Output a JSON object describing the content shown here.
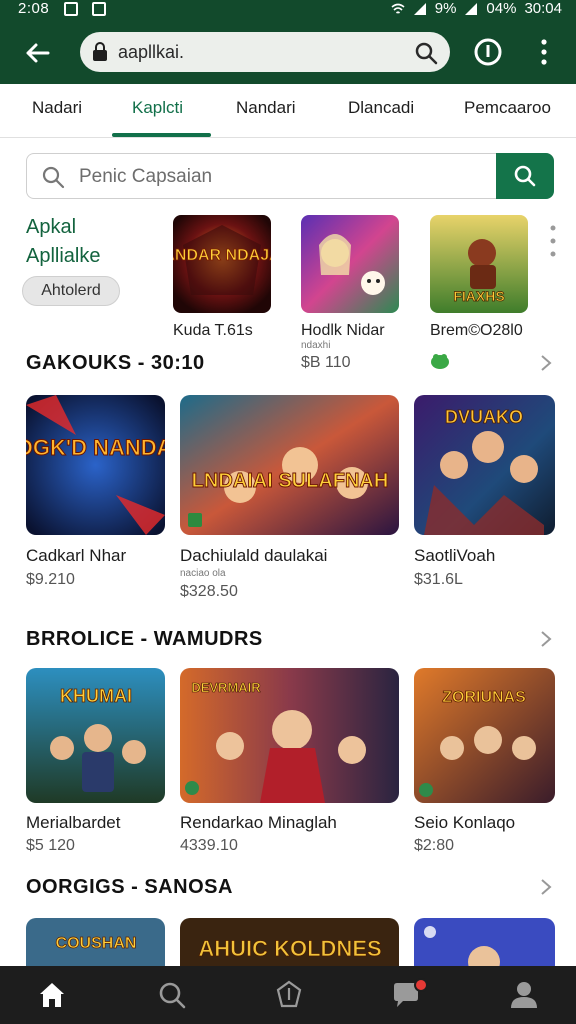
{
  "status_bar": {
    "time": "2:08",
    "battery": "9%",
    "battery2": "04%",
    "clock_right": "30:04"
  },
  "app_bar": {
    "url": "aapllkai.",
    "icons": [
      "arrow-left-icon",
      "lock-icon",
      "search-icon",
      "info-icon",
      "more-vert-icon"
    ]
  },
  "tabs": [
    {
      "label": "Nadari",
      "active": false
    },
    {
      "label": "Kaplcti",
      "active": true
    },
    {
      "label": "Nandari",
      "active": false
    },
    {
      "label": "Dlancadi",
      "active": false
    },
    {
      "label": "Pemcaaroo",
      "active": false
    }
  ],
  "search": {
    "placeholder": "Penic Capsaian"
  },
  "promo": {
    "line1": "Apkal",
    "line2": "Apllialke",
    "chip": "Ahtolerd",
    "apps": [
      {
        "title": "Kuda T.61s",
        "art_text": "NANDAR NDAJAN"
      },
      {
        "title": "Hodlk Nidar",
        "sub": "ndaxhi",
        "price": "$B 110"
      },
      {
        "title": "Brem©O28l0",
        "art_text": "FIAXHS"
      }
    ]
  },
  "sections": [
    {
      "title": "GAKOUKS - 30:10",
      "apps": [
        {
          "name": "Cadkarl Nhar",
          "price": "$9.210",
          "art_text": "JOGK'D NANDAN"
        },
        {
          "name": "Dachiulald daulakai",
          "sub": "naciao ola",
          "price": "$328.50",
          "art_text": "LNDAIAI SULAFNAH"
        },
        {
          "name": "SaotliVoah",
          "price": "$31.6L",
          "art_text": "DVUAKO"
        }
      ]
    },
    {
      "title": "BRROLICE - WAMUDRS",
      "apps": [
        {
          "name": "Merialbardet",
          "price": "$5 120",
          "art_text": "KHUMAI"
        },
        {
          "name": "Rendarkao Minaglah",
          "price": "4339.10",
          "art_text": "DEVRMAIR"
        },
        {
          "name": "Seio Konlaqo",
          "price": "$2:80",
          "art_text": "ZORIUNAS"
        }
      ]
    },
    {
      "title": "OORGIGS - SANOSA",
      "apps": [
        {
          "art_text": "COUSHAN"
        },
        {
          "art_text": "AHUIC KOLDNES"
        },
        {
          "art_text": ""
        }
      ]
    }
  ],
  "bottom_nav": [
    "home-icon",
    "search-icon",
    "shield-icon",
    "chat-icon",
    "profile-icon"
  ],
  "colors": {
    "brand": "#124a2c",
    "accent": "#14744a",
    "nav_bg": "#1d1d1d",
    "badge": "#e53935"
  }
}
